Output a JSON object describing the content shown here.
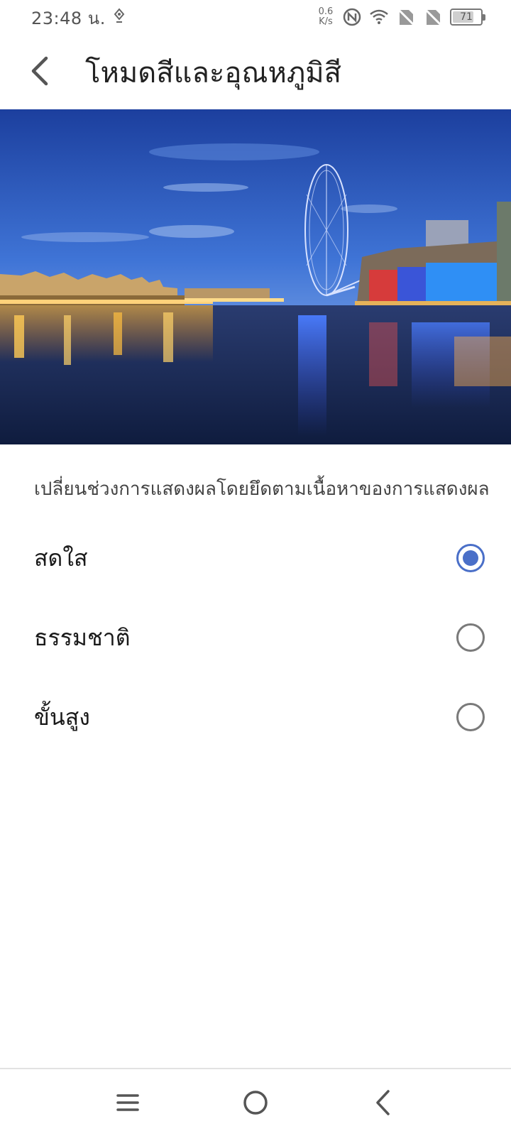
{
  "status_bar": {
    "time": "23:48 น.",
    "net_speed_value": "0.6",
    "net_speed_unit": "K/s",
    "battery_level": "71",
    "icons": [
      "location-pin-icon",
      "nfc-icon",
      "wifi-icon",
      "no-sim-icon",
      "no-sim-icon",
      "battery-icon"
    ]
  },
  "header": {
    "title": "โหมดสีและอุณหภูมิสี",
    "back_icon": "chevron-left-icon"
  },
  "main": {
    "description": "เปลี่ยนช่วงการแสดงผลโดยยึดตามเนื้อหาของการแสดงผล",
    "options": [
      {
        "label": "สดใส",
        "selected": true
      },
      {
        "label": "ธรรมชาติ",
        "selected": false
      },
      {
        "label": "ขั้นสูง",
        "selected": false
      }
    ]
  },
  "nav_bar": {
    "icons": [
      "menu-icon",
      "home-icon",
      "back-icon"
    ]
  },
  "colors": {
    "accent": "#4a6fc8",
    "radio_unchecked": "#7a7a7a"
  }
}
